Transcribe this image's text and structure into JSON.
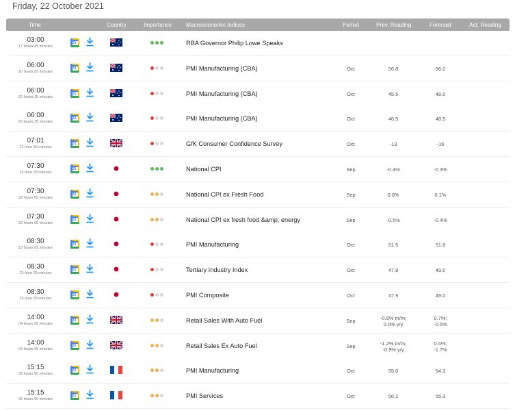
{
  "date_title": "Friday, 22 October 2021",
  "columns": {
    "time": "Time",
    "country": "Country",
    "importance": "Importance",
    "indices": "Macroeconomic Indices",
    "period": "Period",
    "prev": "Prev. Reading",
    "forecast": "Forecast",
    "actual": "Act. Reading"
  },
  "colors": {
    "importance_high": "#5cb85c",
    "importance_medium": "#f0ad4e",
    "importance_low": "#e53935",
    "importance_off": "#d6d6d6",
    "download": "#2196f3"
  },
  "icons": {
    "calendar": "google-calendar-icon",
    "download": "download-icon"
  },
  "events": [
    {
      "time": "03:00",
      "countdown": "17 hours 35 minutes",
      "country": "AU",
      "importance": "high",
      "indicator": "RBA Governor Philip Lowe Speaks",
      "period": "",
      "prev": "",
      "forecast": "",
      "actual": ""
    },
    {
      "time": "06:00",
      "countdown": "20 hours 35 minutes",
      "country": "AU",
      "importance": "low",
      "indicator": "PMI Manufacturing (CBA)",
      "period": "Oct",
      "prev": "56.8",
      "forecast": "56.0",
      "actual": ""
    },
    {
      "time": "06:00",
      "countdown": "20 hours 35 minutes",
      "country": "AU",
      "importance": "low",
      "indicator": "PMI Manufacturing (CBA)",
      "period": "Oct",
      "prev": "45.5",
      "forecast": "48.0",
      "actual": ""
    },
    {
      "time": "06:00",
      "countdown": "20 hours 35 minutes",
      "country": "AU",
      "importance": "low",
      "indicator": "PMI Manufacturing (CBA)",
      "period": "Oct",
      "prev": "46.5",
      "forecast": "48.5",
      "actual": ""
    },
    {
      "time": "07:01",
      "countdown": "21 hour 36 minutes",
      "country": "GB",
      "importance": "low",
      "indicator": "GfK Consumer Confidence Survey",
      "period": "Oct",
      "prev": "-13",
      "forecast": "-16",
      "actual": ""
    },
    {
      "time": "07:30",
      "countdown": "22 hour 05 minutes",
      "country": "JP",
      "importance": "high",
      "indicator": "National CPI",
      "period": "Sep",
      "prev": "-0.4%",
      "forecast": "-0.3%",
      "actual": ""
    },
    {
      "time": "07:30",
      "countdown": "22 hours 05 minutes",
      "country": "JP",
      "importance": "medium",
      "indicator": "National CPI ex Fresh Food",
      "period": "Sep",
      "prev": "0.0%",
      "forecast": "0.1%",
      "actual": ""
    },
    {
      "time": "07:30",
      "countdown": "22 hours 05 minutes",
      "country": "JP",
      "importance": "medium",
      "indicator": "National CPI ex fresh food &amp; energy",
      "period": "Sep",
      "prev": "-0.5%",
      "forecast": "-0.4%",
      "actual": ""
    },
    {
      "time": "08:30",
      "countdown": "23 hours 05 minutes",
      "country": "JP",
      "importance": "low",
      "indicator": "PMI Manufacturing",
      "period": "Oct",
      "prev": "51.5",
      "forecast": "51.6",
      "actual": ""
    },
    {
      "time": "08:30",
      "countdown": "23 hour 05 minutes",
      "country": "JP",
      "importance": "low",
      "indicator": "Tertiary Industry Index",
      "period": "Oct",
      "prev": "47.8",
      "forecast": "49.0",
      "actual": ""
    },
    {
      "time": "08:30",
      "countdown": "23 hour 05 minutes",
      "country": "JP",
      "importance": "low",
      "indicator": "PMI Composite",
      "period": "Oct",
      "prev": "47.9",
      "forecast": "49.0",
      "actual": ""
    },
    {
      "time": "14:00",
      "countdown": "04 hours 35 minutes",
      "country": "GB",
      "importance": "medium",
      "indicator": "Retail Sales With Auto Fuel",
      "period": "Sep",
      "prev": "-0.9% m/m;\n0.0% y/y",
      "forecast": "0.7%;\n-0.5%",
      "actual": ""
    },
    {
      "time": "14:00",
      "countdown": "04 hours 35 minutes",
      "country": "GB",
      "importance": "medium",
      "indicator": "Retail Sales Ex Auto Fuel",
      "period": "Sep",
      "prev": "-1.2% m/m;\n-0.9% y/y",
      "forecast": "0.4%;\n-1.7%",
      "actual": ""
    },
    {
      "time": "15:15",
      "countdown": "05 hours 50 minutes",
      "country": "FR",
      "importance": "medium",
      "indicator": "PMI Manufacturing",
      "period": "Oct",
      "prev": "55.0",
      "forecast": "54.3",
      "actual": ""
    },
    {
      "time": "15:15",
      "countdown": "05 hours 50 minutes",
      "country": "FR",
      "importance": "medium",
      "indicator": "PMI Services",
      "period": "Oct",
      "prev": "56.2",
      "forecast": "55.3",
      "actual": ""
    }
  ]
}
